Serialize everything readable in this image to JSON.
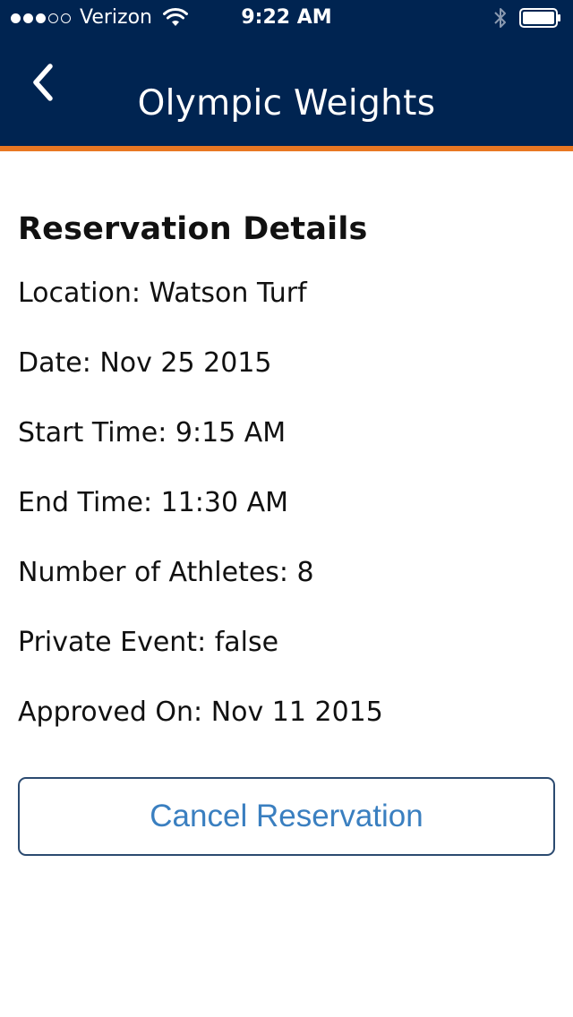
{
  "status_bar": {
    "carrier": "Verizon",
    "time": "9:22 AM",
    "signal_strength": 3,
    "signal_max": 5
  },
  "nav": {
    "title": "Olympic Weights",
    "back_icon": "chevron-left-icon"
  },
  "reservation": {
    "heading": "Reservation Details",
    "details": [
      "Location: Watson Turf",
      "Date: Nov 25 2015",
      "Start Time: 9:15 AM",
      "End Time: 11:30 AM",
      "Number of Athletes: 8",
      "Private Event: false",
      "Approved On: Nov 11 2015"
    ]
  },
  "actions": {
    "cancel_label": "Cancel Reservation"
  },
  "colors": {
    "header_bg": "#002451",
    "accent": "#e87722",
    "button_text": "#3a7fc0",
    "button_border": "#2b4a70"
  }
}
